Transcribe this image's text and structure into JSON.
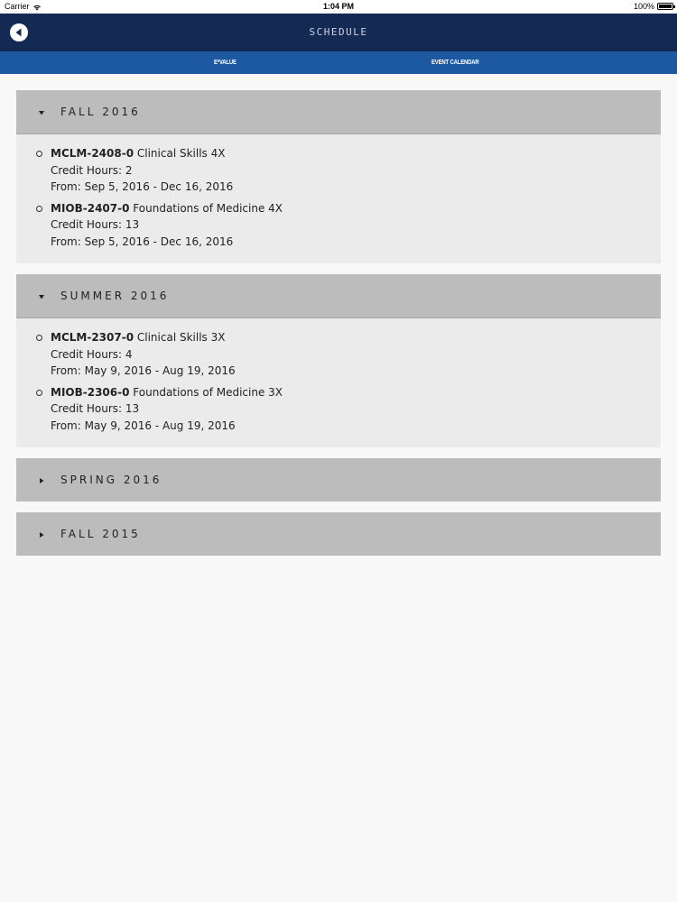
{
  "status_bar": {
    "carrier": "Carrier",
    "time": "1:04 PM",
    "battery": "100%"
  },
  "nav": {
    "title": "SCHEDULE",
    "back_icon": "back-arrow-circle-icon"
  },
  "tabs": [
    {
      "label": "E*VALUE"
    },
    {
      "label": "EVENT CALENDAR"
    }
  ],
  "sections": [
    {
      "title": "FALL 2016",
      "expanded": true,
      "courses": [
        {
          "code": "MCLM-2408-0",
          "name": "Clinical Skills 4X",
          "credit": "Credit Hours: 2",
          "dates": "From: Sep 5, 2016 - Dec 16, 2016"
        },
        {
          "code": "MIOB-2407-0",
          "name": "Foundations of Medicine 4X",
          "credit": "Credit Hours: 13",
          "dates": "From: Sep 5, 2016 - Dec 16, 2016"
        }
      ]
    },
    {
      "title": "SUMMER 2016",
      "expanded": true,
      "courses": [
        {
          "code": "MCLM-2307-0",
          "name": "Clinical Skills 3X",
          "credit": "Credit Hours: 4",
          "dates": "From: May 9, 2016 - Aug 19, 2016"
        },
        {
          "code": "MIOB-2306-0",
          "name": "Foundations of Medicine 3X",
          "credit": "Credit Hours: 13",
          "dates": "From: May 9, 2016 - Aug 19, 2016"
        }
      ]
    },
    {
      "title": "SPRING 2016",
      "expanded": false
    },
    {
      "title": "FALL 2015",
      "expanded": false
    }
  ]
}
